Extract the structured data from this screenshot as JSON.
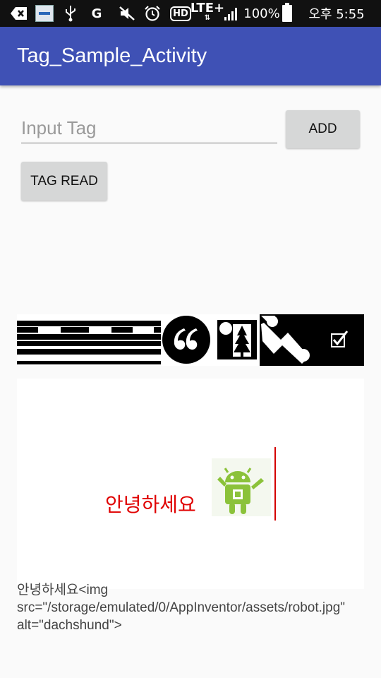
{
  "status_bar": {
    "g_label": "G",
    "hd_label": "HD",
    "lte_label": "LTE+",
    "battery_percent": "100%",
    "time": "오후 5:55",
    "icons": [
      "back-icon",
      "gallery-icon",
      "usb-icon",
      "g-app-icon",
      "mute-icon",
      "alarm-icon",
      "hd-voice-icon",
      "lte-icon",
      "signal-icon",
      "battery-icon"
    ]
  },
  "app_bar": {
    "title": "Tag_Sample_Activity",
    "color": "#3f51b5"
  },
  "tag_input": {
    "value": "",
    "placeholder": "Input Tag"
  },
  "buttons": {
    "add": "ADD",
    "tag_read": "TAG READ"
  },
  "tag_strip": {
    "icons": [
      "horizontal-rule-icon",
      "quote-icon",
      "image-icon",
      "link-icon",
      "checkbox-icon"
    ]
  },
  "preview": {
    "text": "안녕하세요",
    "text_color": "#e00000",
    "image_alt": "dachshund"
  },
  "raw_html": "안녕하세요<img src=\"/storage/emulated/0/AppInventor/assets/robot.jpg\" alt=\"dachshund\">"
}
